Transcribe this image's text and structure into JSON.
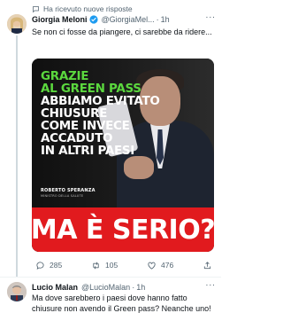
{
  "context": {
    "text": "Ha ricevuto nuove risposte"
  },
  "tweet1": {
    "name": "Giorgia Meloni",
    "handle": "@GiorgiaMel...",
    "time": "1h",
    "text": "Se non ci fosse da piangere, ci sarebbe da ridere...",
    "image": {
      "lines": [
        "GRAZIE",
        "AL GREEN PASS",
        "ABBIAMO EVITATO",
        "CHIUSURE",
        "COME INVECE",
        "ACCADUTO",
        "IN ALTRI PAESI"
      ],
      "caption_name": "ROBERTO SPERANZA",
      "caption_role": "MINISTRO DELLA SALUTE",
      "banner": "MA È SERIO?"
    },
    "actions": {
      "replies": "285",
      "retweets": "105",
      "likes": "476"
    }
  },
  "tweet2": {
    "name": "Lucio Malan",
    "handle": "@LucioMalan",
    "time": "1h",
    "text": "Ma dove sarebbero i paesi dove hanno fatto chiusure non avendo il Green pass? Neanche uno! Bugiardo matricolato"
  },
  "colors": {
    "accent": "#1d9bf0",
    "green": "#5bd83e",
    "banner_red": "#e11a1e",
    "muted": "#536471"
  }
}
